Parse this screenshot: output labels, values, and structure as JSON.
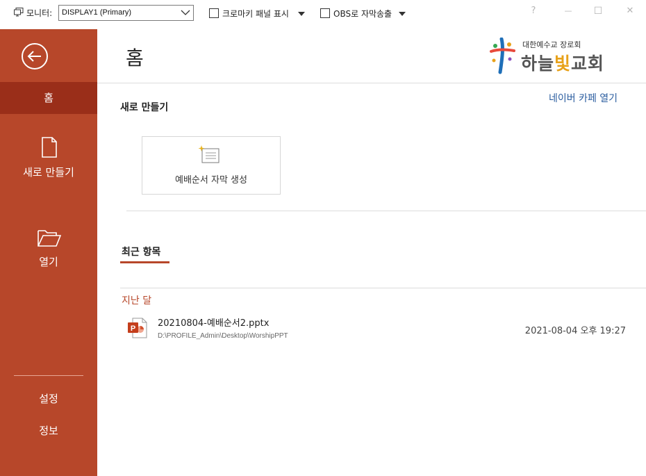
{
  "topbar": {
    "monitor_label": "모니터:",
    "monitor_value": "DISPLAY1 (Primary)",
    "chroma_label": "크로마키 패널 표시",
    "obs_label": "OBS로 자막송출",
    "help": "?",
    "minimize": "—",
    "maximize": "☐",
    "close": "✕"
  },
  "sidebar": {
    "home": "홈",
    "new": "새로 만들기",
    "open": "열기",
    "settings": "설정",
    "info": "정보"
  },
  "main": {
    "title": "홈",
    "cafe_link": "네이버 카페 열기",
    "new_section": "새로 만들기",
    "tile_label": "예배순서 자막 생성",
    "recent_section": "최근 항목",
    "group_label": "지난 달",
    "recent_files": [
      {
        "name": "20210804-예배순서2.pptx",
        "path": "D:\\PROFILE_Admin\\Desktop\\WorshipPPT",
        "date": "2021-08-04 오후 19:27",
        "icon": "powerpoint-icon"
      }
    ]
  },
  "logo": {
    "top_text": "대한예수교 장로회",
    "name_part1": "하늘",
    "name_part2": "빛",
    "name_part3": "교회"
  },
  "colors": {
    "accent": "#b7472a",
    "accent_dark": "#9a2e19",
    "link": "#2b5d9f",
    "logo_highlight": "#e8a21a"
  }
}
